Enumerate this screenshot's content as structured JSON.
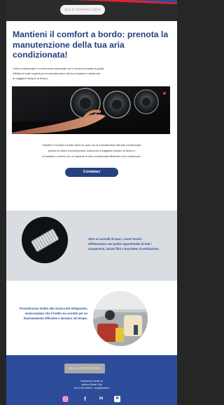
{
  "header": {
    "logo_label": "QUI IL VOSTRO LOGO",
    "accent_red": "#e0242f",
    "accent_blue": "#2c4c9a"
  },
  "intro": {
    "title": "Mantieni il comfort a bordo: prenota la manutenzione della tua aria condizionata!",
    "line1": "L'aria condizionata è un elemento essenziale per il comfort durante la guida.",
    "line2": "Affidati ai nostri esperti per la manutenzione del tuo impianto e assicurati",
    "line3": "di viaggiare sempre al fresco."
  },
  "body": {
    "line1": "Mantieni il comfort a bordo della tua auto con la manutenzione dell'aria condizionata",
    "line2": "presso la nostra concessionaria. Assicurati di viaggiare sempre al fresco e",
    "line3": "al massimo comfort con un impianto di aria condizionata efficiente e ben mantenuto.",
    "cta_label": "Contattaci",
    "cta_color": "#24427f"
  },
  "feature1": {
    "text": "Oltre ai controlli di base, i nostri tecnici effettueranno una pulizia approfondita di tutti i componenti, inclusi filtri e bocchette di ventilazione.",
    "image_icon": "cabin-filter-icon"
  },
  "feature2": {
    "text": "Procederanno inoltre alla ricarica del refrigerante, assicurandosi che il livello sia corretto per un funzionamento efficiente e duraturo nel tempo.",
    "image_icon": "car-interior-icon"
  },
  "footer": {
    "logo_label": "QUI IL VOSTRO LOGO",
    "line1": "Intestazione Dealer srl",
    "line2": "Indirizzo Dealer Città",
    "line3": "Tel 00 000 000000 - email@dealer.it",
    "socials": [
      "instagram-icon",
      "facebook-icon",
      "linkedin-icon",
      "x-icon"
    ],
    "color": "#2c4c9a"
  }
}
